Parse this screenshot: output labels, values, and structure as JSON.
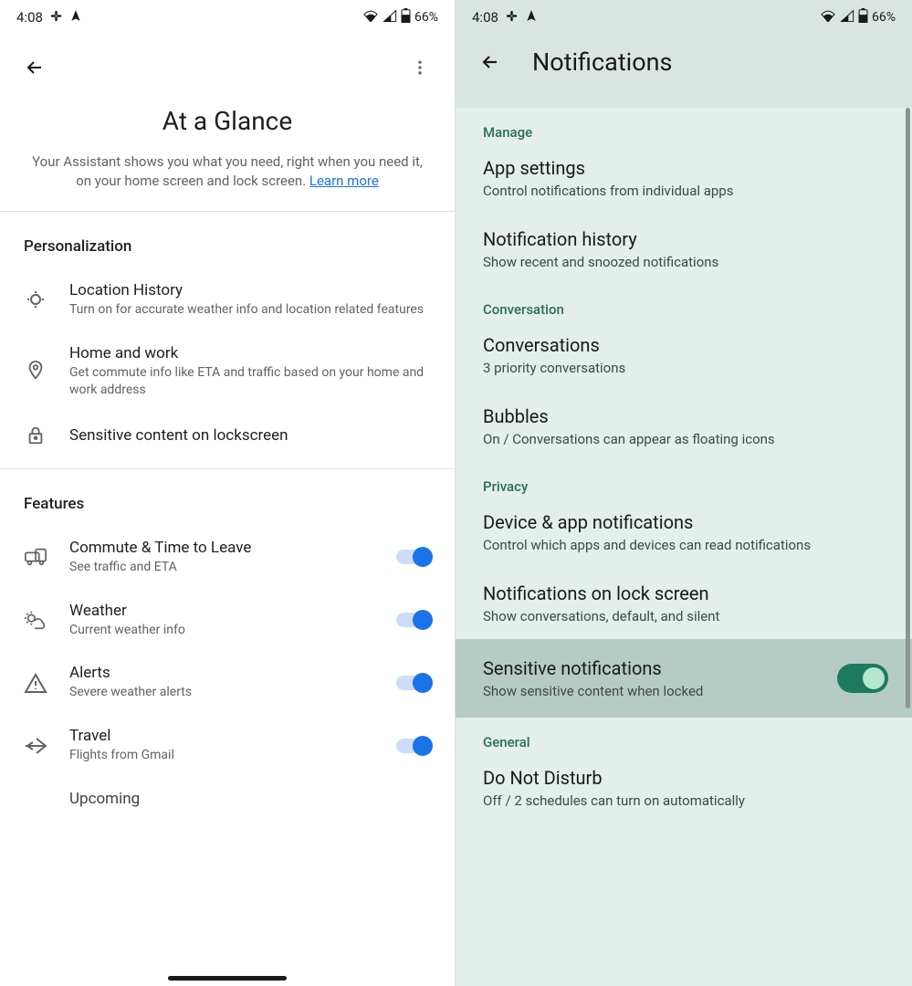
{
  "status": {
    "time": "4:08",
    "battery": "66%"
  },
  "left": {
    "title": "At a Glance",
    "description_pre": "Your Assistant shows you what you need, right when you need it, on your home screen and lock screen. ",
    "learn_more": "Learn more",
    "sections": {
      "personalization": {
        "header": "Personalization",
        "items": [
          {
            "title": "Location History",
            "sub": "Turn on for accurate weather info and location related features"
          },
          {
            "title": "Home and work",
            "sub": "Get commute info like ETA and traffic based on your home and work address"
          },
          {
            "title": "Sensitive content on lockscreen",
            "sub": ""
          }
        ]
      },
      "features": {
        "header": "Features",
        "items": [
          {
            "title": "Commute & Time to Leave",
            "sub": "See traffic and ETA"
          },
          {
            "title": "Weather",
            "sub": "Current weather info"
          },
          {
            "title": "Alerts",
            "sub": "Severe weather alerts"
          },
          {
            "title": "Travel",
            "sub": "Flights from Gmail"
          },
          {
            "title": "Upcoming",
            "sub": ""
          }
        ]
      }
    }
  },
  "right": {
    "title": "Notifications",
    "sections": [
      {
        "header": "Manage",
        "items": [
          {
            "title": "App settings",
            "sub": "Control notifications from individual apps"
          },
          {
            "title": "Notification history",
            "sub": "Show recent and snoozed notifications"
          }
        ]
      },
      {
        "header": "Conversation",
        "items": [
          {
            "title": "Conversations",
            "sub": "3 priority conversations"
          },
          {
            "title": "Bubbles",
            "sub": "On / Conversations can appear as floating icons"
          }
        ]
      },
      {
        "header": "Privacy",
        "items": [
          {
            "title": "Device & app notifications",
            "sub": "Control which apps and devices can read notifications"
          },
          {
            "title": "Notifications on lock screen",
            "sub": "Show conversations, default, and silent"
          },
          {
            "title": "Sensitive notifications",
            "sub": "Show sensitive content when locked",
            "highlight": true,
            "toggle": true
          }
        ]
      },
      {
        "header": "General",
        "items": [
          {
            "title": "Do Not Disturb",
            "sub": "Off / 2 schedules can turn on automatically"
          }
        ]
      }
    ]
  }
}
